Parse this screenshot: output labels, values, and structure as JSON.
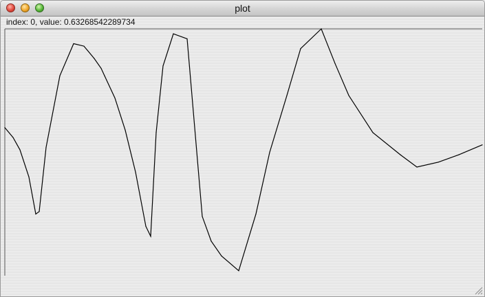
{
  "window": {
    "title": "plot"
  },
  "status": {
    "text": "index: 0, value: 0.63268542289734"
  },
  "icons": {
    "close": "close-icon",
    "minimize": "minimize-icon",
    "zoom": "zoom-icon",
    "resize": "resize-grip-icon"
  },
  "colors": {
    "line": "#000000",
    "frame": "#555555"
  },
  "chart_data": {
    "type": "line",
    "title": "",
    "xlabel": "",
    "ylabel": "",
    "grid": false,
    "ylim": [
      0,
      1
    ],
    "x": [
      0,
      12,
      22,
      35,
      45,
      50,
      60,
      80,
      100,
      115,
      130,
      140,
      145,
      160,
      175,
      190,
      205,
      212,
      220,
      230,
      245,
      265,
      287,
      300,
      315,
      340,
      365,
      385,
      410,
      430,
      460,
      480,
      500,
      535,
      575,
      599,
      630,
      660,
      694
    ],
    "y": [
      0.6,
      0.56,
      0.51,
      0.4,
      0.25,
      0.26,
      0.52,
      0.81,
      0.94,
      0.93,
      0.88,
      0.84,
      0.81,
      0.72,
      0.59,
      0.42,
      0.2,
      0.16,
      0.58,
      0.85,
      0.98,
      0.96,
      0.24,
      0.14,
      0.08,
      0.02,
      0.25,
      0.5,
      0.73,
      0.92,
      1.0,
      0.86,
      0.73,
      0.58,
      0.49,
      0.44,
      0.46,
      0.49,
      0.53
    ]
  }
}
